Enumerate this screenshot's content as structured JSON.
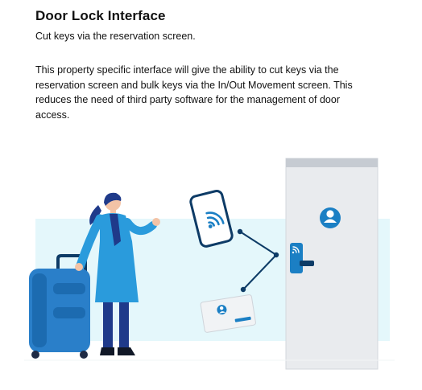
{
  "header": {
    "title": "Door Lock Interface",
    "subtitle": "Cut keys via the reservation screen."
  },
  "body_text": "This property specific interface will give the ability to cut keys via the reservation screen and bulk keys via the In/Out Movement screen. This reduces the need of third party software for the management of door access.",
  "colors": {
    "brand_blue": "#1b7fc4",
    "dark_navy": "#0d3b66",
    "background_band": "#e4f7fb",
    "door": "#e9ebee"
  },
  "icons": [
    "nfc-wireless-icon",
    "user-avatar-icon"
  ]
}
